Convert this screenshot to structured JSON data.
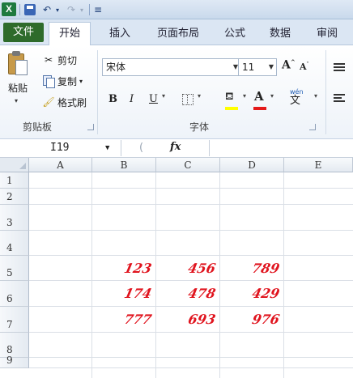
{
  "titlebar": {
    "app_icon": "X",
    "undo_glyph": "↶",
    "redo_glyph": "↷",
    "menu_glyph": "▾",
    "customize_glyph": "≡"
  },
  "tabs": [
    {
      "label": "文件"
    },
    {
      "label": "开始"
    },
    {
      "label": "插入"
    },
    {
      "label": "页面布局"
    },
    {
      "label": "公式"
    },
    {
      "label": "数据"
    },
    {
      "label": "审阅"
    }
  ],
  "clipboard": {
    "paste_label": "粘贴",
    "cut_label": "剪切",
    "copy_label": "复制",
    "format_painter_label": "格式刷",
    "group_label": "剪贴板"
  },
  "font": {
    "font_name": "宋体",
    "font_size": "11",
    "bold": "B",
    "italic": "I",
    "underline": "U",
    "font_color_glyph": "A",
    "phonetic_label": "wén",
    "phonetic_char": "文",
    "group_label": "字体",
    "fill_color": "#ffff00",
    "font_color": "#e41a1a"
  },
  "formula_bar": {
    "name_box": "I19",
    "fx": "fx",
    "value": ""
  },
  "grid": {
    "columns": [
      "A",
      "B",
      "C",
      "D",
      "E"
    ],
    "rows": [
      "1",
      "2",
      "3",
      "4",
      "5",
      "6",
      "7",
      "8",
      "9"
    ],
    "cells": {
      "B5": "123",
      "C5": "456",
      "D5": "789",
      "B6": "174",
      "C6": "478",
      "D6": "429",
      "B7": "777",
      "C7": "693",
      "D7": "976"
    },
    "cell_color": "#e0141e"
  }
}
